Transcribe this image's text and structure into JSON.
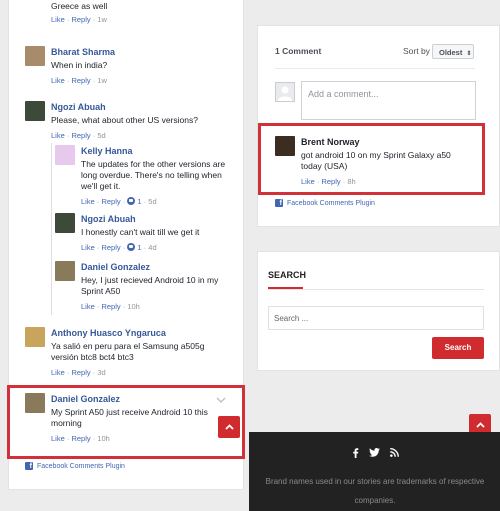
{
  "colors": {
    "accent": "#d02b2f",
    "link": "#4267b2",
    "name": "#365899",
    "highlight": "#d3313a",
    "footer_bg": "#222222"
  },
  "left": {
    "top_comment": {
      "text": "Greece as well",
      "like": "Like",
      "reply": "Reply",
      "time": "1w"
    },
    "comments": [
      {
        "name": "Bharat Sharma",
        "text": "When in india?",
        "like": "Like",
        "reply": "Reply",
        "time": "1w"
      },
      {
        "name": "Ngozi Abuah",
        "text": "Please, what about other US versions?",
        "like": "Like",
        "reply": "Reply",
        "time": "5d"
      },
      {
        "name": "Kelly Hanna",
        "text": "The updates for the other versions are long overdue. There's no telling when we'll get it.",
        "like": "Like",
        "reply": "Reply",
        "count": "1",
        "time": "5d"
      },
      {
        "name": "Ngozi Abuah",
        "text": "I honestly can't wait till we get it",
        "like": "Like",
        "reply": "Reply",
        "count": "1",
        "time": "4d"
      },
      {
        "name": "Daniel Gonzalez",
        "text": "Hey, I just recieved Android 10 in my Sprint A50",
        "like": "Like",
        "reply": "Reply",
        "time": "10h"
      },
      {
        "name": "Anthony Huasco Yngaruca",
        "text": "Ya salió en peru para el Samsung a505g versión btc8 bct4 btc3",
        "like": "Like",
        "reply": "Reply",
        "time": "3d"
      },
      {
        "name": "Daniel Gonzalez",
        "text": "My Sprint A50 just receive Android 10 this morning",
        "like": "Like",
        "reply": "Reply",
        "time": "10h"
      }
    ],
    "plugin": "Facebook Comments Plugin"
  },
  "right": {
    "comment_count": "1 Comment",
    "sort_label": "Sort by",
    "sort_value": "Oldest",
    "add_placeholder": "Add a comment...",
    "comment": {
      "name": "Brent Norway",
      "text": "got android 10 on my Sprint Galaxy a50 today (USA)",
      "like": "Like",
      "reply": "Reply",
      "time": "8h"
    },
    "plugin": "Facebook Comments Plugin"
  },
  "search": {
    "title": "SEARCH",
    "placeholder": "Search ...",
    "button": "Search"
  },
  "footer": {
    "text": "Brand names used in our stories are trademarks of respective companies."
  }
}
